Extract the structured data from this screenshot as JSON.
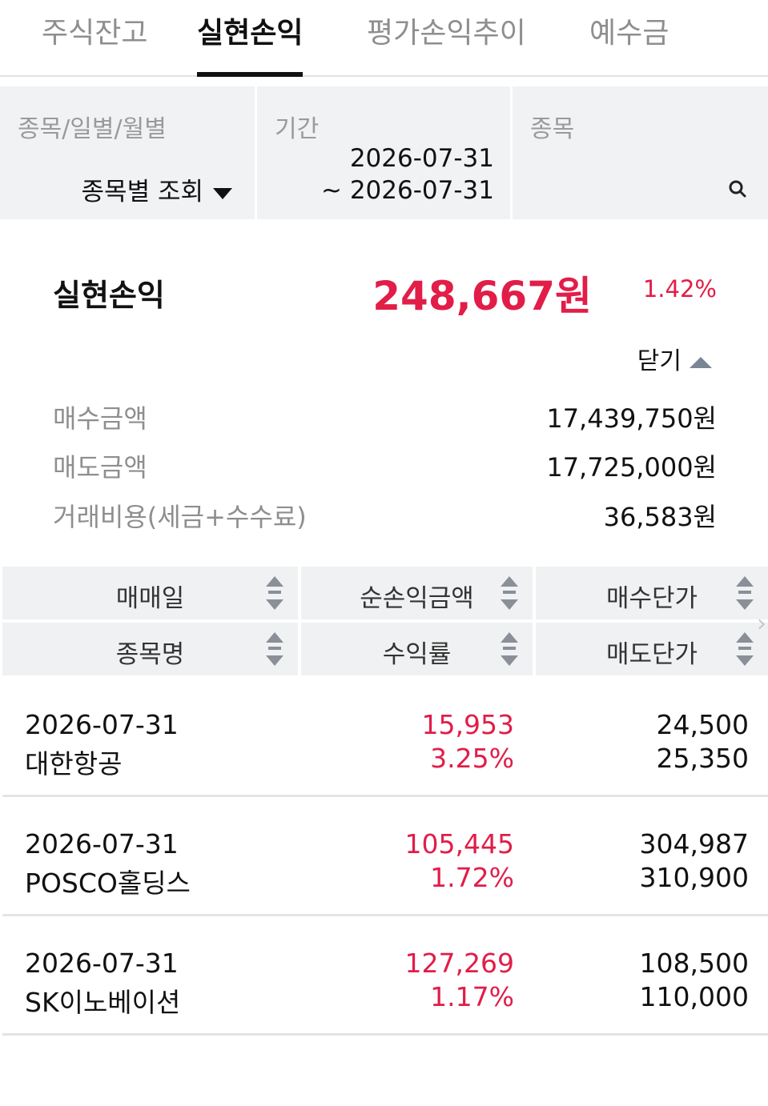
{
  "tabs": [
    {
      "label": "주식잔고"
    },
    {
      "label": "실현손익"
    },
    {
      "label": "평가손익추이"
    },
    {
      "label": "예수금"
    }
  ],
  "filters": {
    "view_label": "종목/일별/월별",
    "view_value": "종목별 조회",
    "period_label": "기간",
    "period_start": "2026-07-31",
    "period_end": "~ 2026-07-31",
    "stock_label": "종목"
  },
  "summary": {
    "title": "실현손익",
    "amount": "248,667원",
    "rate": "1.42%",
    "toggle_label": "닫기",
    "details": [
      {
        "label": "매수금액",
        "value": "17,439,750원"
      },
      {
        "label": "매도금액",
        "value": "17,725,000원"
      },
      {
        "label": "거래비용(세금+수수료)",
        "value": "36,583원"
      }
    ]
  },
  "table": {
    "headers": {
      "r1": [
        "매매일",
        "순손익금액",
        "매수단가"
      ],
      "r2": [
        "종목명",
        "수익률",
        "매도단가"
      ]
    },
    "rows": [
      {
        "date": "2026-07-31",
        "name": "대한항공",
        "profit": "15,953",
        "rate": "3.25%",
        "buy_price": "24,500",
        "sell_price": "25,350"
      },
      {
        "date": "2026-07-31",
        "name": "POSCO홀딩스",
        "profit": "105,445",
        "rate": "1.72%",
        "buy_price": "304,987",
        "sell_price": "310,900"
      },
      {
        "date": "2026-07-31",
        "name": "SK이노베이션",
        "profit": "127,269",
        "rate": "1.17%",
        "buy_price": "108,500",
        "sell_price": "110,000"
      }
    ]
  },
  "colors": {
    "accent_red": "#e11d48",
    "panel_bg": "#f1f2f4",
    "muted_text": "#8e8e8e"
  },
  "icons": {
    "dropdown": "caret-down-icon",
    "search": "search-icon",
    "collapse": "caret-up-icon",
    "sort": "sort-icon",
    "scroll": "chevron-right-icon"
  }
}
